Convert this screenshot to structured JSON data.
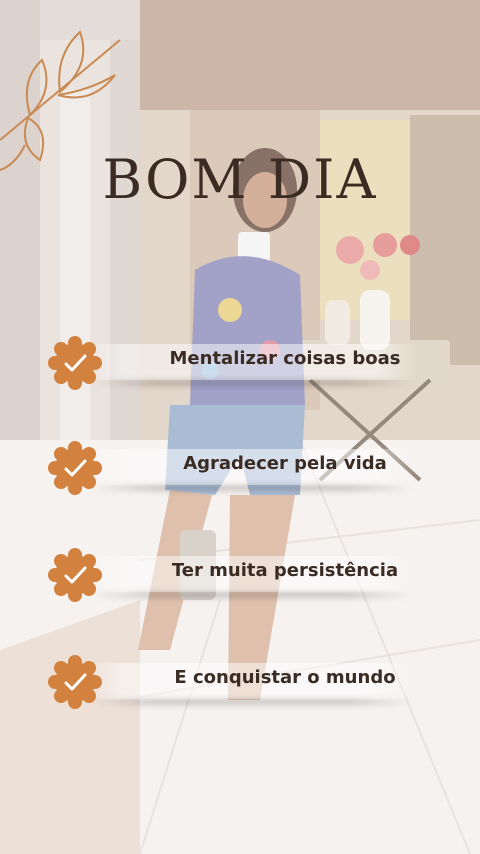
{
  "story": {
    "title": "BOM DIA",
    "items": [
      {
        "label": "Mentalizar coisas boas"
      },
      {
        "label": "Agradecer pela vida"
      },
      {
        "label": "Ter muita persistência"
      },
      {
        "label": "E conquistar o mundo"
      }
    ]
  },
  "colors": {
    "accent": "#d2823e",
    "text": "#3a2b23",
    "leaf": "#c98a53"
  },
  "icons": {
    "leaf": "leaf-branch-icon",
    "check": "check-badge-icon"
  }
}
